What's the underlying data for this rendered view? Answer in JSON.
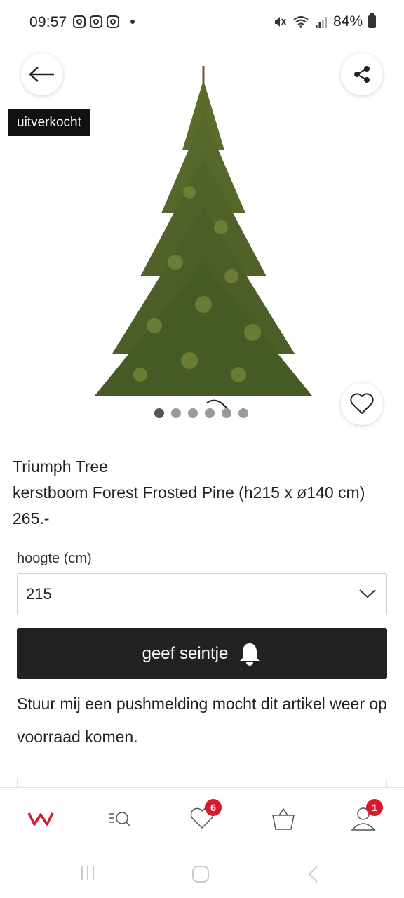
{
  "status_bar": {
    "time": "09:57",
    "battery": "84%",
    "left_icons": [
      "instagram-icon",
      "instagram-icon",
      "instagram-icon",
      "notification-dot-icon"
    ],
    "right_icons": [
      "mute-icon",
      "wifi-icon",
      "signal-icon",
      "battery-icon"
    ]
  },
  "hero": {
    "sold_out_label": "uitverkocht",
    "image_count": 6,
    "active_image": 1
  },
  "product": {
    "brand": "Triumph Tree",
    "title": "kerstboom Forest Frosted Pine (h215 x ø140 cm)",
    "price": "265.-"
  },
  "size_select": {
    "label": "hoogte (cm)",
    "value": "215"
  },
  "notify": {
    "button_label": "geef seintje",
    "description": "Stuur mij een pushmelding mocht dit artikel weer op voorraad komen."
  },
  "bottom_nav": {
    "items": [
      "home-logo",
      "search-icon",
      "wishlist-icon",
      "basket-icon",
      "account-icon"
    ],
    "wishlist_count": "6",
    "account_count": "1"
  },
  "colors": {
    "accent": "#d6192f",
    "button": "#222222",
    "badge_bg": "#111111"
  }
}
